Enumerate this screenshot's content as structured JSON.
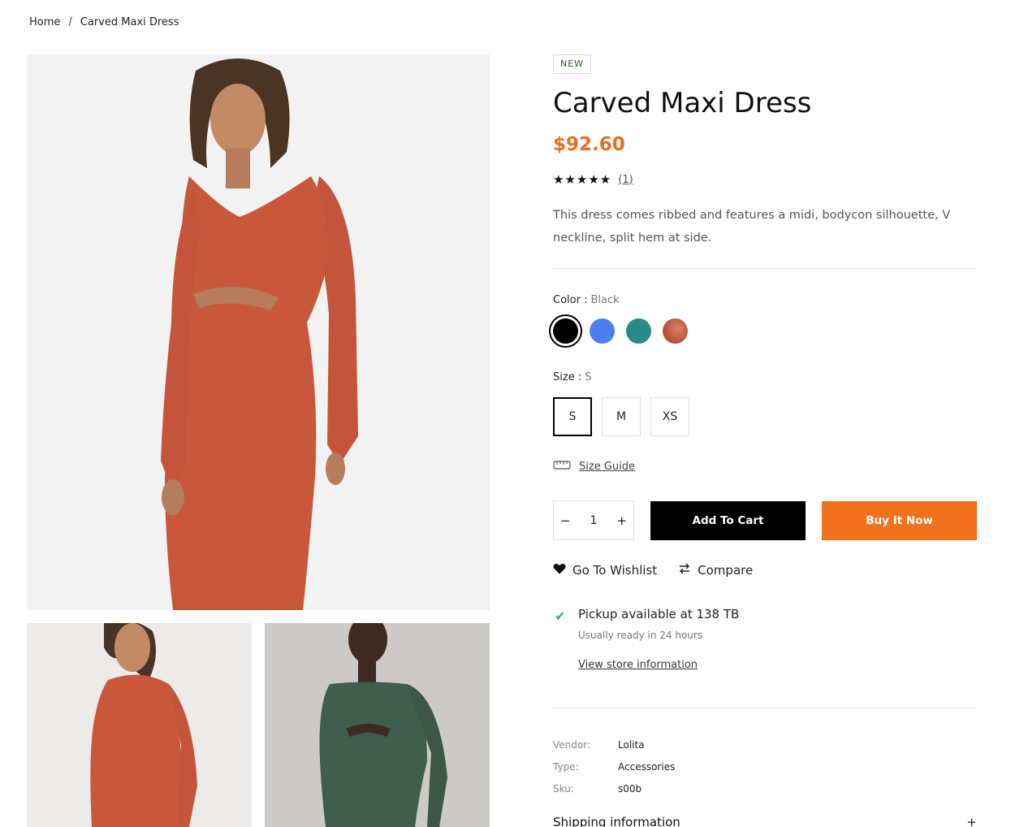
{
  "breadcrumb": {
    "home": "Home",
    "separator": "/",
    "current": "Carved Maxi Dress"
  },
  "product": {
    "badge": "NEW",
    "title": "Carved Maxi Dress",
    "price": "$92.60",
    "stars": "★★★★★",
    "review_count": "(1)",
    "description": "This dress comes ribbed and features a midi, bodycon silhouette, V neckline, split hem at side."
  },
  "options": {
    "color_label": "Color :",
    "color_value": "Black",
    "colors": [
      "#000000",
      "#4f7df2",
      "#278b86",
      "#b24e33"
    ],
    "size_label": "Size :",
    "size_value": "S",
    "sizes": [
      "S",
      "M",
      "XS"
    ],
    "size_guide": "Size Guide"
  },
  "purchase": {
    "qty_minus": "−",
    "qty_value": "1",
    "qty_plus": "+",
    "add_to_cart": "Add To Cart",
    "buy_now": "Buy It Now"
  },
  "actions": {
    "wishlist": "Go To Wishlist",
    "compare": "Compare"
  },
  "pickup": {
    "title": "Pickup available at 138 TB",
    "subtitle": "Usually ready in 24 hours",
    "link": "View store information"
  },
  "meta": {
    "vendor_label": "Vendor:",
    "vendor": "Lolita",
    "type_label": "Type:",
    "type": "Accessories",
    "sku_label": "Sku:",
    "sku": "s00b"
  },
  "shipping": {
    "label": "Shipping information",
    "toggle": "+"
  },
  "colors": {
    "accent": "#e96e1f",
    "button_dark": "#000000",
    "button_orange": "#f1711f",
    "check": "#3cb54a"
  }
}
